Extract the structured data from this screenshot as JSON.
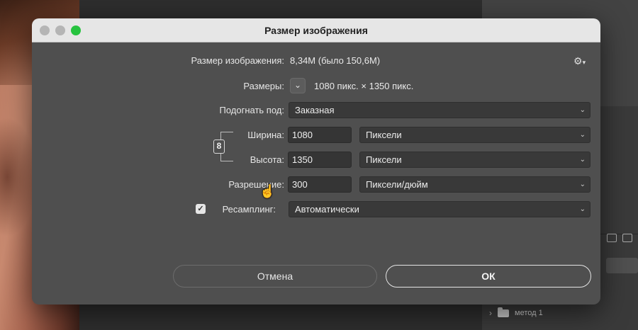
{
  "dialog": {
    "title": "Размер изображения",
    "image_size": {
      "label": "Размер изображения:",
      "value": "8,34M (было 150,6M)"
    },
    "dimensions": {
      "label": "Размеры:",
      "value": "1080 пикс.  ×  1350 пикс.",
      "toggle_glyph": "⌄"
    },
    "fit_to": {
      "label": "Подогнать под:",
      "selected": "Заказная"
    },
    "width": {
      "label": "Ширина:",
      "value": "1080",
      "unit": "Пиксели"
    },
    "height": {
      "label": "Высота:",
      "value": "1350",
      "unit": "Пиксели"
    },
    "resolution": {
      "label": "Разрешение:",
      "value": "300",
      "unit": "Пиксели/дюйм"
    },
    "resample": {
      "label": "Ресамплинг:",
      "checked": true,
      "selected": "Автоматически"
    },
    "buttons": {
      "cancel": "Отмена",
      "ok": "ОК"
    }
  },
  "background": {
    "layer_name": "метод 1"
  },
  "icons": {
    "gear": "gear-icon",
    "link": "chain-link-icon",
    "chevron": "chevron-down-icon",
    "folder": "folder-icon",
    "cursor": "hand-pointer-icon"
  },
  "colors": {
    "dialog_bg": "#4f4f4f",
    "titlebar_bg": "#e6e6e6",
    "zoom_button": "#27c33f",
    "field_bg": "#393939"
  }
}
